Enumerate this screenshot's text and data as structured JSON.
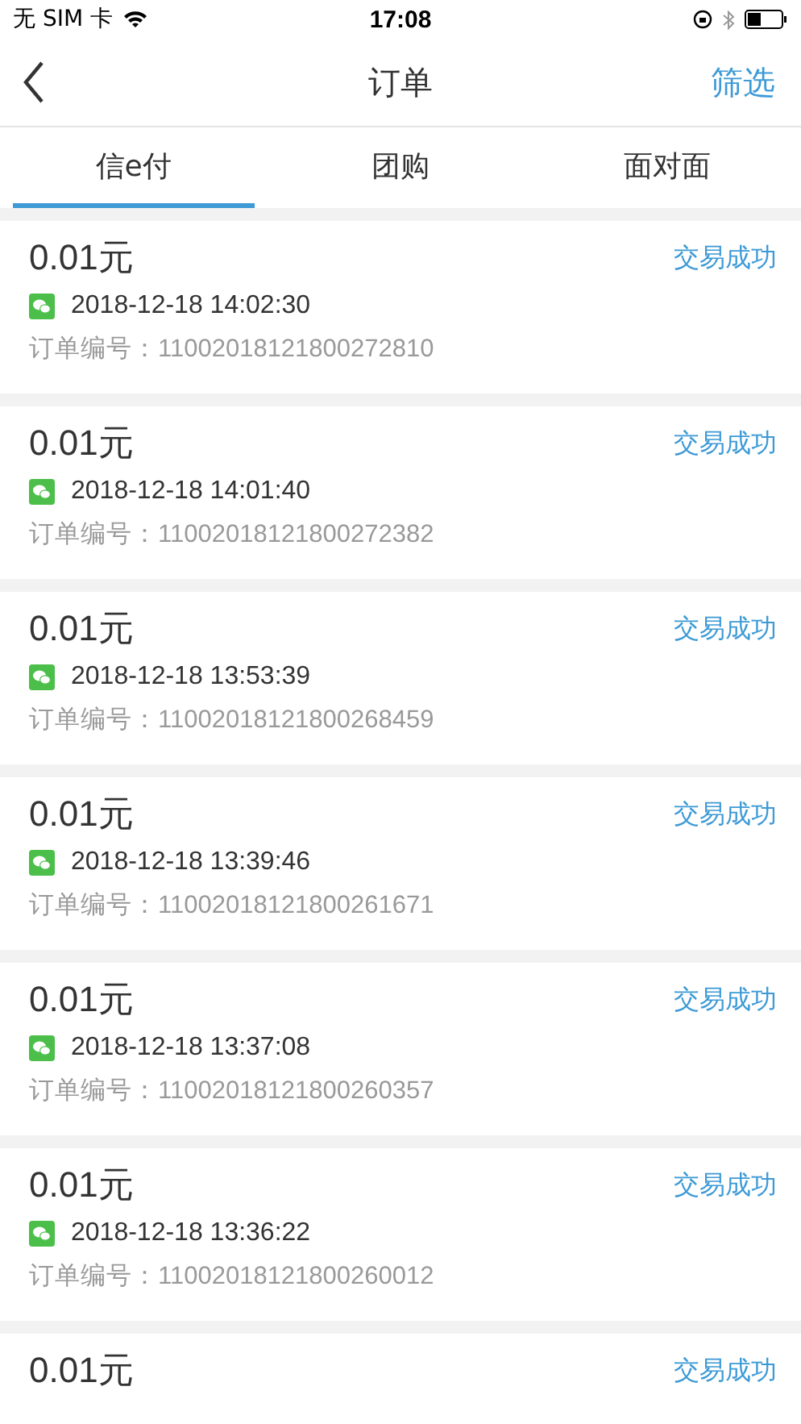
{
  "status_bar": {
    "carrier": "无 SIM 卡",
    "time": "17:08"
  },
  "nav": {
    "title": "订单",
    "action": "筛选"
  },
  "tabs": [
    {
      "label": "信e付",
      "selected": true
    },
    {
      "label": "团购",
      "selected": false
    },
    {
      "label": "面对面",
      "selected": false
    }
  ],
  "orders": [
    {
      "amount": "0.01元",
      "status": "交易成功",
      "time": "2018-12-18 14:02:30",
      "order_no": "订单编号：11002018121800272810"
    },
    {
      "amount": "0.01元",
      "status": "交易成功",
      "time": "2018-12-18 14:01:40",
      "order_no": "订单编号：11002018121800272382"
    },
    {
      "amount": "0.01元",
      "status": "交易成功",
      "time": "2018-12-18 13:53:39",
      "order_no": "订单编号：11002018121800268459"
    },
    {
      "amount": "0.01元",
      "status": "交易成功",
      "time": "2018-12-18 13:39:46",
      "order_no": "订单编号：11002018121800261671"
    },
    {
      "amount": "0.01元",
      "status": "交易成功",
      "time": "2018-12-18 13:37:08",
      "order_no": "订单编号：11002018121800260357"
    },
    {
      "amount": "0.01元",
      "status": "交易成功",
      "time": "2018-12-18 13:36:22",
      "order_no": "订单编号：11002018121800260012"
    },
    {
      "amount": "0.01元",
      "status": "交易成功"
    }
  ]
}
